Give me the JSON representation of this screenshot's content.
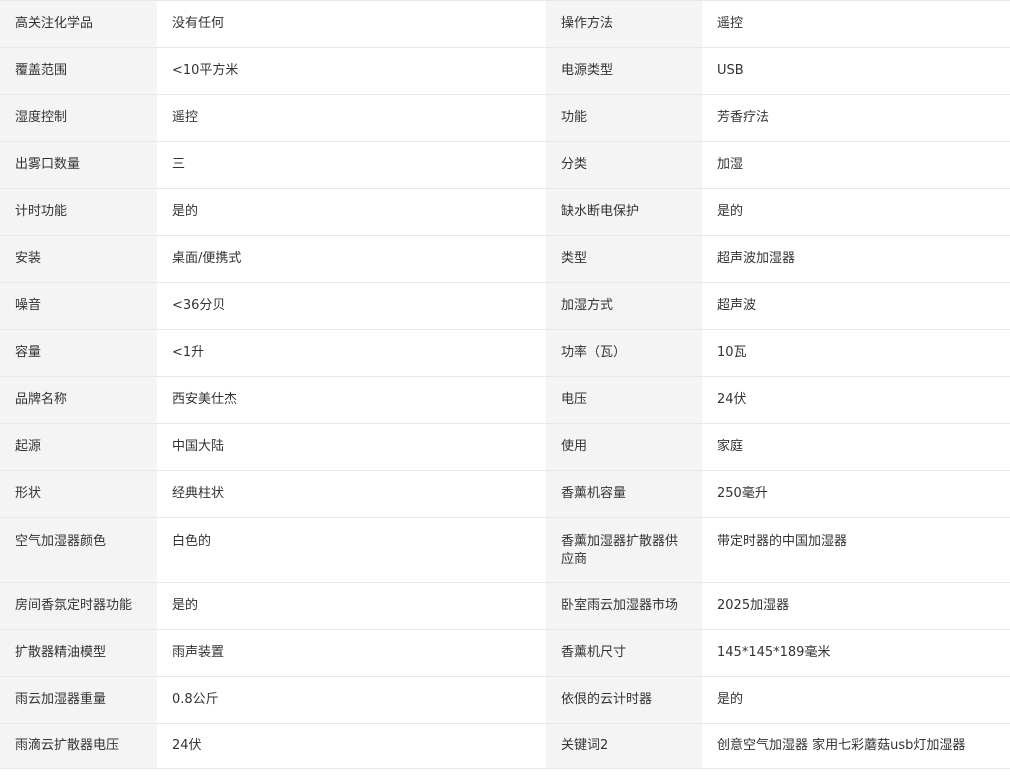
{
  "spec_rows": [
    {
      "k1": "高关注化学品",
      "v1": "没有任何",
      "k2": "操作方法",
      "v2": "遥控"
    },
    {
      "k1": "覆盖范围",
      "v1": "<10平方米",
      "k2": "电源类型",
      "v2": "USB"
    },
    {
      "k1": "湿度控制",
      "v1": "遥控",
      "k2": "功能",
      "v2": "芳香疗法"
    },
    {
      "k1": "出雾口数量",
      "v1": "三",
      "k2": "分类",
      "v2": "加湿"
    },
    {
      "k1": "计时功能",
      "v1": "是的",
      "k2": "缺水断电保护",
      "v2": "是的"
    },
    {
      "k1": "安装",
      "v1": "桌面/便携式",
      "k2": "类型",
      "v2": "超声波加湿器"
    },
    {
      "k1": "噪音",
      "v1": "<36分贝",
      "k2": "加湿方式",
      "v2": "超声波"
    },
    {
      "k1": "容量",
      "v1": "<1升",
      "k2": "功率（瓦）",
      "v2": "10瓦"
    },
    {
      "k1": "品牌名称",
      "v1": "西安美仕杰",
      "k2": "电压",
      "v2": "24伏"
    },
    {
      "k1": "起源",
      "v1": "中国大陆",
      "k2": "使用",
      "v2": "家庭"
    },
    {
      "k1": "形状",
      "v1": "经典柱状",
      "k2": "香薰机容量",
      "v2": "250毫升"
    },
    {
      "k1": "空气加湿器颜色",
      "v1": "白色的",
      "k2": "香薰加湿器扩散器供应商",
      "v2": "带定时器的中国加湿器"
    },
    {
      "k1": "房间香氛定时器功能",
      "v1": "是的",
      "k2": "卧室雨云加湿器市场",
      "v2": "2025加湿器"
    },
    {
      "k1": "扩散器精油模型",
      "v1": "雨声装置",
      "k2": "香薰机尺寸",
      "v2": "145*145*189毫米"
    },
    {
      "k1": "雨云加湿器重量",
      "v1": "0.8公斤",
      "k2": "依佷的云计时器",
      "v2": "是的"
    },
    {
      "k1": "雨滴云扩散器电压",
      "v1": "24伏",
      "k2": "关键词2",
      "v2": "创意空气加湿器 家用七彩蘑菇usb灯加湿器"
    }
  ]
}
